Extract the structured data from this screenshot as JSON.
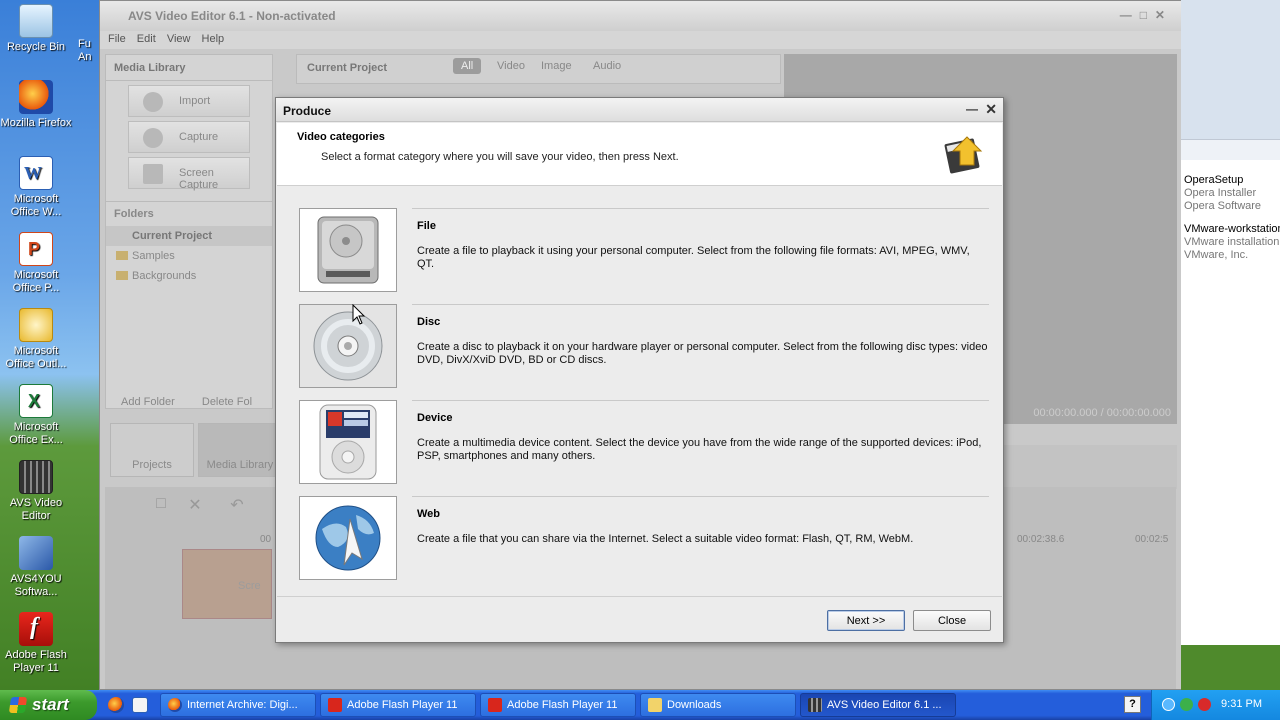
{
  "desktop": {
    "icons": [
      {
        "label": "Recycle Bin",
        "icon": "recycle-bin-icon"
      },
      {
        "label": "Mozilla Firefox",
        "icon": "firefox-icon"
      },
      {
        "label": "Microsoft Office W...",
        "icon": "word-icon"
      },
      {
        "label": "Microsoft Office P...",
        "icon": "powerpoint-icon"
      },
      {
        "label": "Microsoft Office Outl...",
        "icon": "outlook-icon"
      },
      {
        "label": "Microsoft Office Ex...",
        "icon": "excel-icon"
      },
      {
        "label": "AVS Video Editor",
        "icon": "avs-video-editor-icon"
      },
      {
        "label": "AVS4YOU Softwa...",
        "icon": "avs4you-icon"
      },
      {
        "label": "Adobe Flash Player 11",
        "icon": "flash-player-icon"
      }
    ],
    "partial_icon_label": "Fu An"
  },
  "avs_window": {
    "title": "AVS Video Editor 6.1 - Non-activated",
    "menu": [
      "File",
      "Edit",
      "View",
      "Help"
    ],
    "media_library": {
      "heading": "Media Library",
      "buttons": [
        "Import",
        "Capture",
        "Screen Capture"
      ],
      "folders_heading": "Folders",
      "folders": [
        "Current Project",
        "Samples",
        "Backgrounds"
      ],
      "add_folder": "Add Folder",
      "delete_folder": "Delete Fol"
    },
    "bottom_tabs": [
      "Projects",
      "Media Library"
    ],
    "current_project": {
      "heading": "Current Project",
      "filters": [
        "All",
        "Video",
        "Image",
        "Audio"
      ],
      "selected_filter": "All"
    },
    "preview": {
      "time": "00:00:00.000 / 00:00:00.000"
    },
    "timeline": {
      "times": [
        "00",
        "00:02:38.6",
        "00:02:5"
      ],
      "clip_label": "Scre"
    }
  },
  "right_window": {
    "entries": [
      {
        "title": "OperaSetup",
        "line1": "Opera Installer",
        "line2": "Opera Software"
      },
      {
        "title": "VMware-workstation",
        "line1": "VMware installation l",
        "line2": "VMware, Inc."
      }
    ]
  },
  "dialog": {
    "title": "Produce",
    "header_title": "Video categories",
    "header_subtitle": "Select a format category where you will save your video, then press Next.",
    "categories": [
      {
        "title": "File",
        "icon": "hard-drive-icon",
        "description": "Create a file to playback it using your personal computer. Select from the following file formats: AVI, MPEG, WMV, QT."
      },
      {
        "title": "Disc",
        "icon": "disc-icon",
        "description": "Create a disc to playback it on your hardware player or personal computer. Select from the following disc types: video DVD, DivX/XviD DVD, BD or CD discs."
      },
      {
        "title": "Device",
        "icon": "ipod-icon",
        "description": "Create a multimedia device content. Select the device you have from the wide range of the supported devices: iPod, PSP, smartphones and many others."
      },
      {
        "title": "Web",
        "icon": "globe-icon",
        "description": "Create a file that you can share via the Internet. Select a suitable video format: Flash, QT, RM, WebM."
      }
    ],
    "buttons": {
      "next": "Next >>",
      "close": "Close"
    }
  },
  "taskbar": {
    "start_label": "start",
    "tasks": [
      {
        "label": "Internet Archive: Digi...",
        "icon": "firefox-icon",
        "active": false
      },
      {
        "label": "Adobe Flash Player 11",
        "icon": "flash-player-icon",
        "active": false
      },
      {
        "label": "Adobe Flash Player 11",
        "icon": "flash-player-icon",
        "active": false
      },
      {
        "label": "Downloads",
        "icon": "folder-icon",
        "active": false
      },
      {
        "label": "AVS Video Editor 6.1 ...",
        "icon": "avs-video-editor-icon",
        "active": true
      }
    ],
    "help_label": "?",
    "clock": "9:31 PM"
  },
  "colors": {
    "taskbar": "#245edb",
    "start": "#3c9a2c",
    "dialog_bg": "#ececec",
    "tray": "#1488e0"
  }
}
